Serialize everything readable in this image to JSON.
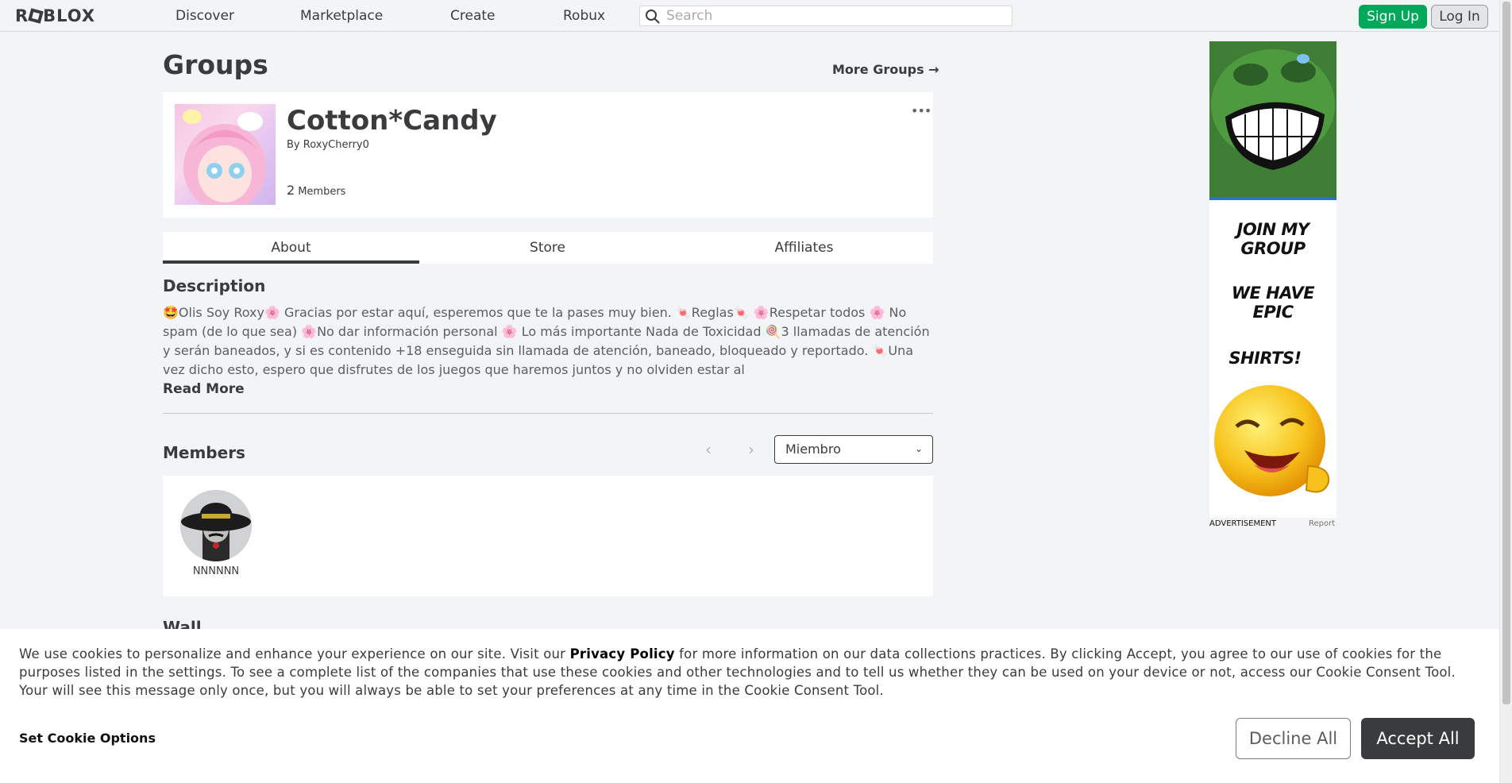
{
  "nav": {
    "logo": "ROBLOX",
    "links": [
      "Discover",
      "Marketplace",
      "Create",
      "Robux"
    ],
    "search_placeholder": "Search",
    "signup_label": "Sign Up",
    "login_label": "Log In"
  },
  "page": {
    "title": "Groups",
    "more_groups": "More Groups →"
  },
  "group": {
    "name": "Cotton*Candy",
    "by_label": "By",
    "owner": "RoxyCherry0",
    "member_count": "2",
    "members_label": "Members",
    "menu_label": "•••"
  },
  "tabs": [
    "About",
    "Store",
    "Affiliates"
  ],
  "about": {
    "description_title": "Description",
    "description_text": "🤩Olis Soy Roxy🌸 Gracias por estar aquí, esperemos que te la pases muy bien. 🍬Reglas🍬 🌸Respetar todos 🌸 No spam (de lo que sea) 🌸No dar información personal 🌸 Lo más importante Nada de Toxicidad 🍭3 llamadas de atención y serán baneados, y si es contenido +18 enseguida sin llamada de atención, baneado, bloqueado y reportado. 🍬Una vez dicho esto, espero que disfrutes de los juegos que haremos juntos y no olviden estar al",
    "read_more": "Read More"
  },
  "members": {
    "title": "Members",
    "prev_icon": "‹",
    "next_icon": "›",
    "role_selected": "Miembro",
    "list": [
      {
        "name": "NNNNNN"
      }
    ]
  },
  "wall": {
    "title": "Wall"
  },
  "ad": {
    "lines": [
      "JOIN MY GROUP",
      "WE HAVE EPIC",
      "SHIRTS!"
    ],
    "label": "ADVERTISEMENT",
    "report": "Report"
  },
  "cookie": {
    "text_before": "We use cookies to personalize and enhance your experience on our site. Visit our ",
    "privacy_link": "Privacy Policy",
    "text_after": " for more information on our data collections practices. By clicking Accept, you agree to our use of cookies for the purposes listed in the settings. To see a complete list of the companies that use these cookies and other technologies and to tell us whether they can be used on your device or not, access our Cookie Consent Tool. Your will see this message only once, but you will always be able to set your preferences at any time in the Cookie Consent Tool.",
    "set_options": "Set Cookie Options",
    "decline": "Decline All",
    "accept": "Accept All"
  },
  "colors": {
    "signup_green": "#00a85a",
    "text_dark": "#393b3d",
    "background": "#f2f4f5"
  }
}
